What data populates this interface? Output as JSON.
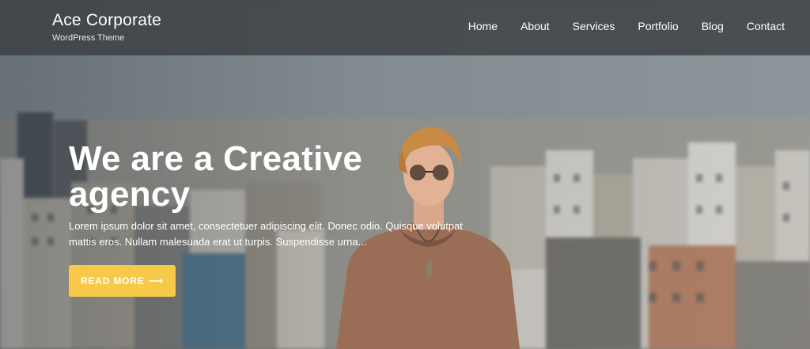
{
  "header": {
    "site_title": "Ace Corporate",
    "site_description": "WordPress Theme"
  },
  "nav": {
    "items": [
      "Home",
      "About",
      "Services",
      "Portfolio",
      "Blog",
      "Contact"
    ]
  },
  "hero": {
    "headline": "We are a Creative agency",
    "description": "Lorem ipsum dolor sit amet, consectetuer adipiscing elit. Donec odio. Quisque volutpat mattis eros. Nullam malesuada erat ut turpis. Suspendisse urna...",
    "button_label": "READ MORE",
    "button_icon": "arrow-right-icon",
    "button_color": "#f7c948"
  }
}
